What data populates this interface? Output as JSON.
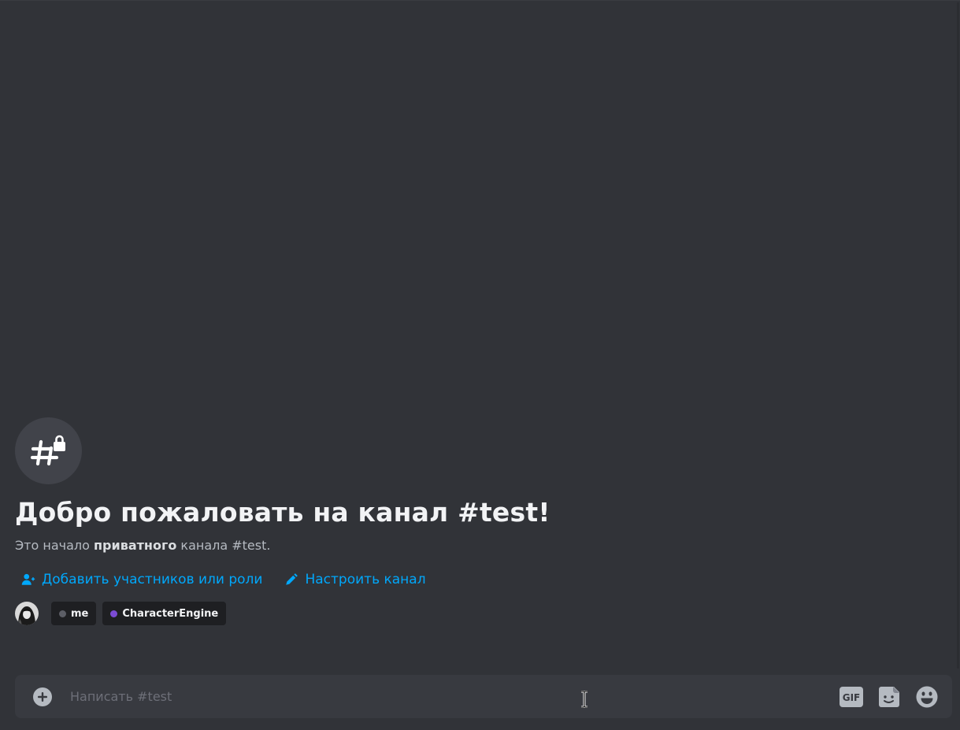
{
  "welcome": {
    "title": "Добро пожаловать на канал #test!",
    "subtitle_prefix": "Это начало ",
    "subtitle_bold": "приватного",
    "subtitle_suffix": " канала #test."
  },
  "actions": {
    "add_members_label": "Добавить участников или роли",
    "edit_channel_label": "Настроить канал"
  },
  "members": [
    {
      "name": "me",
      "role_color": "#5c5e66"
    },
    {
      "name": "CharacterEngine",
      "role_color": "#7b4bd4"
    }
  ],
  "composer": {
    "placeholder": "Написать #test",
    "gif_label": "GIF"
  },
  "colors": {
    "background": "#313338",
    "link": "#00a8fc",
    "icon": "#b5bac1"
  }
}
